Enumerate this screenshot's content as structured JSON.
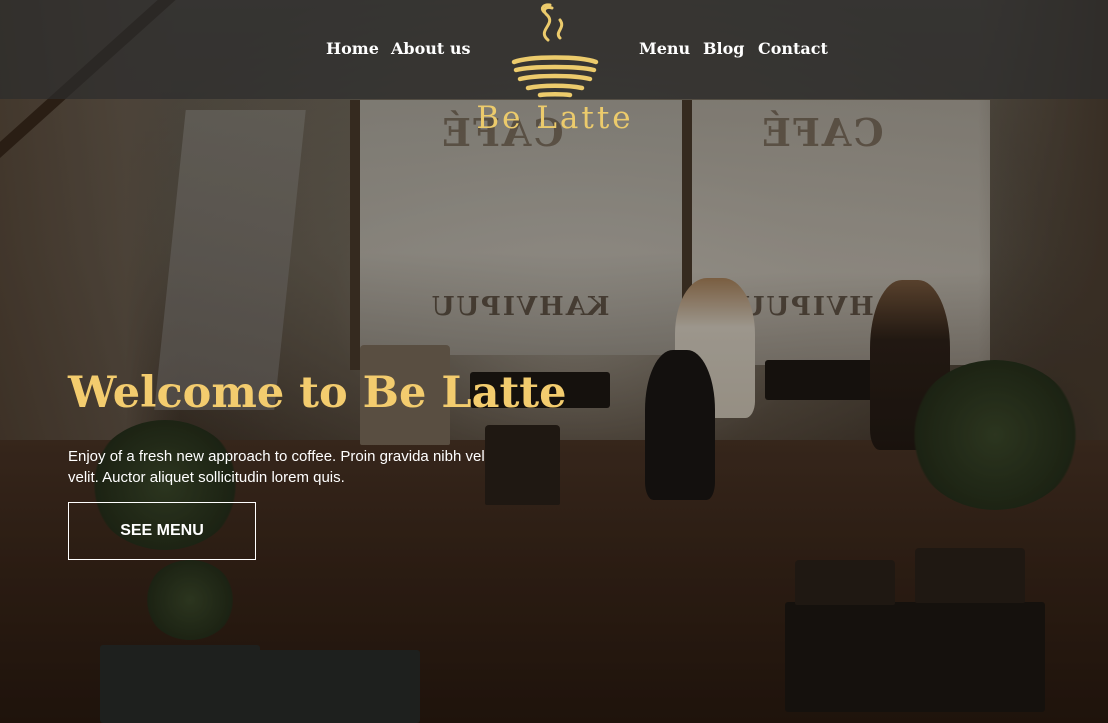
{
  "nav": {
    "items": [
      {
        "label": "Home"
      },
      {
        "label": "About us"
      },
      {
        "label": "Menu"
      },
      {
        "label": "Blog"
      },
      {
        "label": "Contact"
      }
    ]
  },
  "logo": {
    "name": "Be Latte",
    "icon": "steaming-cup-icon",
    "color": "#eccb6c"
  },
  "background": {
    "window_lettering": [
      "KAHVIPUU",
      "KAHVIPUU",
      "CAFÉ",
      "CAFÉ"
    ]
  },
  "hero": {
    "title": "Welcome to Be Latte",
    "description": "Enjoy of a fresh new approach to coffee. Proin gravida nibh vel velit. Auctor aliquet sollicitudin lorem quis.",
    "cta_label": "SEE MENU",
    "title_color": "#f3cc6e"
  }
}
